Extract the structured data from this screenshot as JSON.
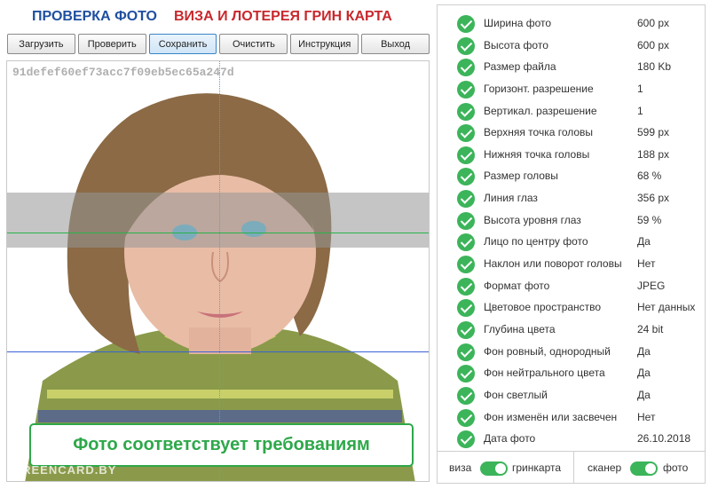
{
  "header": {
    "title_check": "ПРОВЕРКА ФОТО",
    "title_visa": "ВИЗА И ЛОТЕРЕЯ ГРИН КАРТА"
  },
  "toolbar": [
    "Загрузить",
    "Проверить",
    "Сохранить",
    "Очистить",
    "Инструкция",
    "Выход"
  ],
  "photo": {
    "hash": "91defef60ef73acc7f09eb5ec65a247d",
    "verdict": "Фото соответствует требованиям",
    "watermark": "GREENCARD.BY"
  },
  "checks": [
    {
      "label": "Ширина фото",
      "value": "600 px"
    },
    {
      "label": "Высота фото",
      "value": "600 px"
    },
    {
      "label": "Размер файла",
      "value": "180 Kb"
    },
    {
      "label": "Горизонт. разрешение",
      "value": "1"
    },
    {
      "label": "Вертикал. разрешение",
      "value": "1"
    },
    {
      "label": "Верхняя точка головы",
      "value": "599 px"
    },
    {
      "label": "Нижняя точка головы",
      "value": "188 px"
    },
    {
      "label": "Размер головы",
      "value": "68 %"
    },
    {
      "label": "Линия глаз",
      "value": "356 px"
    },
    {
      "label": "Высота уровня глаз",
      "value": "59 %"
    },
    {
      "label": "Лицо по центру фото",
      "value": "Да"
    },
    {
      "label": "Наклон или поворот головы",
      "value": "Нет"
    },
    {
      "label": "Формат фото",
      "value": "JPEG"
    },
    {
      "label": "Цветовое пространство",
      "value": "Нет данных"
    },
    {
      "label": "Глубина цвета",
      "value": "24 bit"
    },
    {
      "label": "Фон ровный, однородный",
      "value": "Да"
    },
    {
      "label": "Фон нейтрального цвета",
      "value": "Да"
    },
    {
      "label": "Фон светлый",
      "value": "Да"
    },
    {
      "label": "Фон изменён или засвечен",
      "value": "Нет"
    },
    {
      "label": "Дата фото",
      "value": "26.10.2018"
    }
  ],
  "switches": {
    "left_off": "виза",
    "left_on": "гринкарта",
    "right_off": "сканер",
    "right_on": "фото"
  }
}
